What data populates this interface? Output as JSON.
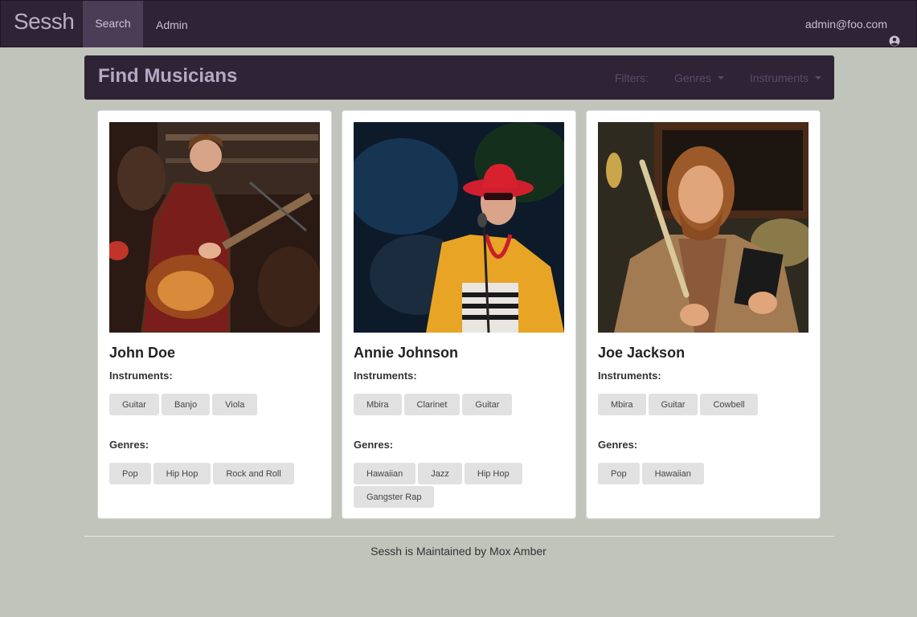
{
  "nav": {
    "brand": "Sessh",
    "items": [
      {
        "label": "Search",
        "active": true
      },
      {
        "label": "Admin",
        "active": false
      }
    ],
    "user_email": "admin@foo.com",
    "user_icon": "user-circle-icon"
  },
  "header": {
    "title": "Find Musicians",
    "filters_label": "Filters:",
    "dropdowns": [
      {
        "label": "Genres"
      },
      {
        "label": "Instruments"
      }
    ]
  },
  "labels": {
    "instruments": "Instruments:",
    "genres": "Genres:"
  },
  "musicians": [
    {
      "name": "John Doe",
      "instruments": [
        "Guitar",
        "Banjo",
        "Viola"
      ],
      "genres": [
        "Pop",
        "Hip Hop",
        "Rock and Roll"
      ]
    },
    {
      "name": "Annie Johnson",
      "instruments": [
        "Mbira",
        "Clarinet",
        "Guitar"
      ],
      "genres": [
        "Hawaiian",
        "Jazz",
        "Hip Hop",
        "Gangster Rap"
      ]
    },
    {
      "name": "Joe Jackson",
      "instruments": [
        "Mbira",
        "Guitar",
        "Cowbell"
      ],
      "genres": [
        "Pop",
        "Hawaiian"
      ]
    }
  ],
  "footer": {
    "text": "Sessh is Maintained by Mox Amber"
  },
  "colors": {
    "nav_bg": "#2f2336",
    "page_bg": "#c0c4bb",
    "tag_bg": "#e1e1e1"
  }
}
